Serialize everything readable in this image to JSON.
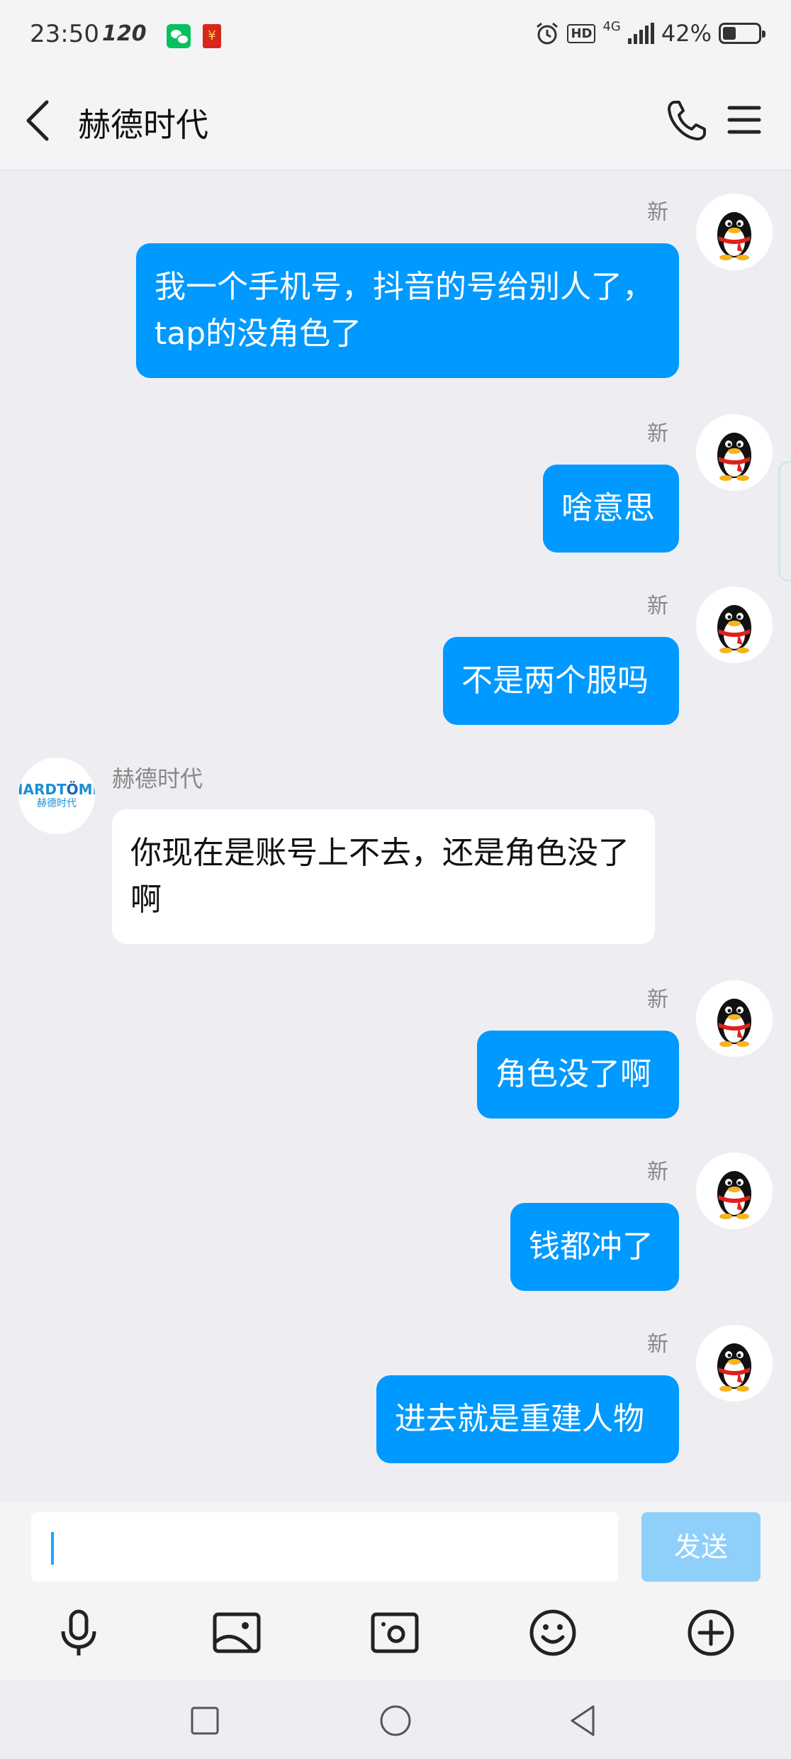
{
  "status_bar": {
    "time": "23:50",
    "refresh_rate": "120",
    "network": "4G",
    "battery": "42%"
  },
  "header": {
    "title": "赫德时代"
  },
  "messages": [
    {
      "direction": "out",
      "tag": "新",
      "text": "我一个手机号，抖音的号给别人了，tap的没角色了"
    },
    {
      "direction": "out",
      "tag": "新",
      "text": "啥意思"
    },
    {
      "direction": "out",
      "tag": "新",
      "text": "不是两个服吗"
    },
    {
      "direction": "in",
      "sender": "赫德时代",
      "text": "你现在是账号上不去，还是角色没了啊"
    },
    {
      "direction": "out",
      "tag": "新",
      "text": "角色没了啊"
    },
    {
      "direction": "out",
      "tag": "新",
      "text": "钱都冲了"
    },
    {
      "direction": "out",
      "tag": "新",
      "text": "进去就是重建人物"
    }
  ],
  "composer": {
    "input_value": "",
    "send_label": "发送",
    "tools": [
      "microphone-icon",
      "image-icon",
      "camera-icon",
      "emoji-icon",
      "plus-icon"
    ]
  },
  "colors": {
    "outgoing_bubble": "#0099ff",
    "incoming_bubble": "#ffffff",
    "send_button": "#8fd0fb",
    "background": "#eeeef2"
  }
}
